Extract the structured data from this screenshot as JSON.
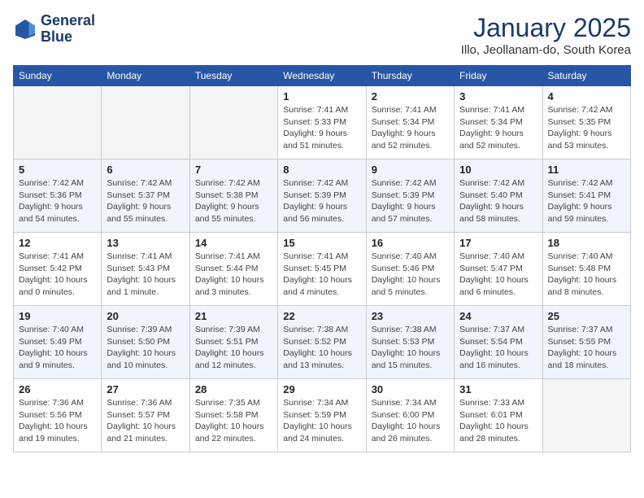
{
  "header": {
    "logo_line1": "General",
    "logo_line2": "Blue",
    "month": "January 2025",
    "location": "Illo, Jeollanam-do, South Korea"
  },
  "days_of_week": [
    "Sunday",
    "Monday",
    "Tuesday",
    "Wednesday",
    "Thursday",
    "Friday",
    "Saturday"
  ],
  "weeks": [
    [
      {
        "day": "",
        "text": ""
      },
      {
        "day": "",
        "text": ""
      },
      {
        "day": "",
        "text": ""
      },
      {
        "day": "1",
        "text": "Sunrise: 7:41 AM\nSunset: 5:33 PM\nDaylight: 9 hours\nand 51 minutes."
      },
      {
        "day": "2",
        "text": "Sunrise: 7:41 AM\nSunset: 5:34 PM\nDaylight: 9 hours\nand 52 minutes."
      },
      {
        "day": "3",
        "text": "Sunrise: 7:41 AM\nSunset: 5:34 PM\nDaylight: 9 hours\nand 52 minutes."
      },
      {
        "day": "4",
        "text": "Sunrise: 7:42 AM\nSunset: 5:35 PM\nDaylight: 9 hours\nand 53 minutes."
      }
    ],
    [
      {
        "day": "5",
        "text": "Sunrise: 7:42 AM\nSunset: 5:36 PM\nDaylight: 9 hours\nand 54 minutes."
      },
      {
        "day": "6",
        "text": "Sunrise: 7:42 AM\nSunset: 5:37 PM\nDaylight: 9 hours\nand 55 minutes."
      },
      {
        "day": "7",
        "text": "Sunrise: 7:42 AM\nSunset: 5:38 PM\nDaylight: 9 hours\nand 55 minutes."
      },
      {
        "day": "8",
        "text": "Sunrise: 7:42 AM\nSunset: 5:39 PM\nDaylight: 9 hours\nand 56 minutes."
      },
      {
        "day": "9",
        "text": "Sunrise: 7:42 AM\nSunset: 5:39 PM\nDaylight: 9 hours\nand 57 minutes."
      },
      {
        "day": "10",
        "text": "Sunrise: 7:42 AM\nSunset: 5:40 PM\nDaylight: 9 hours\nand 58 minutes."
      },
      {
        "day": "11",
        "text": "Sunrise: 7:42 AM\nSunset: 5:41 PM\nDaylight: 9 hours\nand 59 minutes."
      }
    ],
    [
      {
        "day": "12",
        "text": "Sunrise: 7:41 AM\nSunset: 5:42 PM\nDaylight: 10 hours\nand 0 minutes."
      },
      {
        "day": "13",
        "text": "Sunrise: 7:41 AM\nSunset: 5:43 PM\nDaylight: 10 hours\nand 1 minute."
      },
      {
        "day": "14",
        "text": "Sunrise: 7:41 AM\nSunset: 5:44 PM\nDaylight: 10 hours\nand 3 minutes."
      },
      {
        "day": "15",
        "text": "Sunrise: 7:41 AM\nSunset: 5:45 PM\nDaylight: 10 hours\nand 4 minutes."
      },
      {
        "day": "16",
        "text": "Sunrise: 7:40 AM\nSunset: 5:46 PM\nDaylight: 10 hours\nand 5 minutes."
      },
      {
        "day": "17",
        "text": "Sunrise: 7:40 AM\nSunset: 5:47 PM\nDaylight: 10 hours\nand 6 minutes."
      },
      {
        "day": "18",
        "text": "Sunrise: 7:40 AM\nSunset: 5:48 PM\nDaylight: 10 hours\nand 8 minutes."
      }
    ],
    [
      {
        "day": "19",
        "text": "Sunrise: 7:40 AM\nSunset: 5:49 PM\nDaylight: 10 hours\nand 9 minutes."
      },
      {
        "day": "20",
        "text": "Sunrise: 7:39 AM\nSunset: 5:50 PM\nDaylight: 10 hours\nand 10 minutes."
      },
      {
        "day": "21",
        "text": "Sunrise: 7:39 AM\nSunset: 5:51 PM\nDaylight: 10 hours\nand 12 minutes."
      },
      {
        "day": "22",
        "text": "Sunrise: 7:38 AM\nSunset: 5:52 PM\nDaylight: 10 hours\nand 13 minutes."
      },
      {
        "day": "23",
        "text": "Sunrise: 7:38 AM\nSunset: 5:53 PM\nDaylight: 10 hours\nand 15 minutes."
      },
      {
        "day": "24",
        "text": "Sunrise: 7:37 AM\nSunset: 5:54 PM\nDaylight: 10 hours\nand 16 minutes."
      },
      {
        "day": "25",
        "text": "Sunrise: 7:37 AM\nSunset: 5:55 PM\nDaylight: 10 hours\nand 18 minutes."
      }
    ],
    [
      {
        "day": "26",
        "text": "Sunrise: 7:36 AM\nSunset: 5:56 PM\nDaylight: 10 hours\nand 19 minutes."
      },
      {
        "day": "27",
        "text": "Sunrise: 7:36 AM\nSunset: 5:57 PM\nDaylight: 10 hours\nand 21 minutes."
      },
      {
        "day": "28",
        "text": "Sunrise: 7:35 AM\nSunset: 5:58 PM\nDaylight: 10 hours\nand 22 minutes."
      },
      {
        "day": "29",
        "text": "Sunrise: 7:34 AM\nSunset: 5:59 PM\nDaylight: 10 hours\nand 24 minutes."
      },
      {
        "day": "30",
        "text": "Sunrise: 7:34 AM\nSunset: 6:00 PM\nDaylight: 10 hours\nand 26 minutes."
      },
      {
        "day": "31",
        "text": "Sunrise: 7:33 AM\nSunset: 6:01 PM\nDaylight: 10 hours\nand 28 minutes."
      },
      {
        "day": "",
        "text": ""
      }
    ]
  ]
}
